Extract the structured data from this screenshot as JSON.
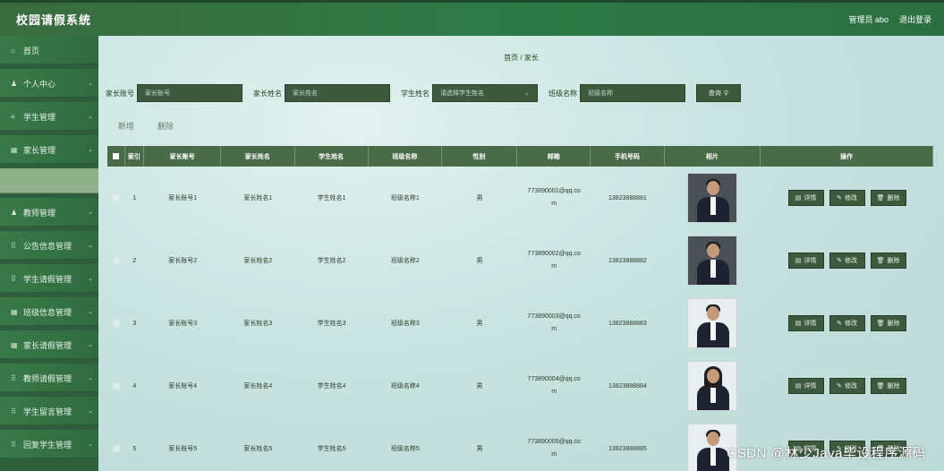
{
  "header": {
    "app_title": "校园请假系统",
    "admin_label": "管理员 abo",
    "logout_label": "退出登录"
  },
  "sidebar": {
    "items": [
      {
        "label": "首页",
        "icon": "home-icon",
        "glyph": "⌂",
        "chevron": false
      },
      {
        "label": "个人中心",
        "icon": "user-icon",
        "glyph": "♟",
        "chevron": true
      },
      {
        "label": "学生管理",
        "icon": "list-icon",
        "glyph": "≡",
        "chevron": true
      },
      {
        "label": "家长管理",
        "icon": "grid-icon",
        "glyph": "▦",
        "chevron": true
      },
      {
        "label": "",
        "icon": "",
        "glyph": "",
        "chevron": false,
        "selected": true
      },
      {
        "label": "教师管理",
        "icon": "user-icon",
        "glyph": "♟",
        "chevron": true
      },
      {
        "label": "公告信息管理",
        "icon": "grid-icon",
        "glyph": "⠿",
        "chevron": true
      },
      {
        "label": "学生请假管理",
        "icon": "grid-icon",
        "glyph": "⠿",
        "chevron": true
      },
      {
        "label": "班级信息管理",
        "icon": "grid-icon",
        "glyph": "▦",
        "chevron": true
      },
      {
        "label": "家长请假管理",
        "icon": "grid-icon",
        "glyph": "▦",
        "chevron": true
      },
      {
        "label": "教师请假管理",
        "icon": "grid-icon",
        "glyph": "⠿",
        "chevron": true
      },
      {
        "label": "学生留言管理",
        "icon": "grid-icon",
        "glyph": "⠿",
        "chevron": true
      },
      {
        "label": "回复学生管理",
        "icon": "grid-icon",
        "glyph": "⠿",
        "chevron": true
      }
    ]
  },
  "breadcrumb": "首页 / 家长",
  "search": {
    "account_label": "家长账号",
    "account_placeholder": "家长账号",
    "name_label": "家长姓名",
    "name_placeholder": "家长姓名",
    "student_label": "学生姓名",
    "student_placeholder": "请选择学生姓名",
    "class_label": "班级名称",
    "class_placeholder": "班级名称",
    "query_label": "查询"
  },
  "toolbar": {
    "add_label": "新增",
    "delete_label": "删除"
  },
  "table": {
    "columns": [
      "索引",
      "家长账号",
      "家长姓名",
      "学生姓名",
      "班级名称",
      "性别",
      "邮箱",
      "手机号码",
      "相片",
      "操作"
    ],
    "rows": [
      {
        "idx": "1",
        "account": "家长账号1",
        "name": "家长姓名1",
        "student": "学生姓名1",
        "class": "班级名称1",
        "sex": "男",
        "mail_a": "773890001@qq.co",
        "mail_b": "m",
        "tel": "13823888881",
        "photo": "dark-male"
      },
      {
        "idx": "2",
        "account": "家长账号2",
        "name": "家长姓名2",
        "student": "学生姓名2",
        "class": "班级名称2",
        "sex": "男",
        "mail_a": "773890002@qq.co",
        "mail_b": "m",
        "tel": "13823888882",
        "photo": "dark-male"
      },
      {
        "idx": "3",
        "account": "家长账号3",
        "name": "家长姓名3",
        "student": "学生姓名3",
        "class": "班级名称3",
        "sex": "男",
        "mail_a": "773890003@qq.co",
        "mail_b": "m",
        "tel": "13823888883",
        "photo": "male"
      },
      {
        "idx": "4",
        "account": "家长账号4",
        "name": "家长姓名4",
        "student": "学生姓名4",
        "class": "班级名称4",
        "sex": "男",
        "mail_a": "773890004@qq.co",
        "mail_b": "m",
        "tel": "13823888884",
        "photo": "female"
      },
      {
        "idx": "5",
        "account": "家长账号5",
        "name": "家长姓名5",
        "student": "学生姓名5",
        "class": "班级名称5",
        "sex": "男",
        "mail_a": "773890005@qq.co",
        "mail_b": "m",
        "tel": "13823888885",
        "photo": "male"
      }
    ],
    "ops": {
      "detail": "详情",
      "edit": "修改",
      "delete": "删除"
    }
  },
  "watermark": "CSDN @林少Java毕设程序源码",
  "colors": {
    "header_green": "#2f7a48",
    "sidebar_green": "#2e5e3c",
    "table_header": "#4a6b48",
    "button_dark": "#3d5a3e",
    "main_bg": "#c8e3e0"
  }
}
